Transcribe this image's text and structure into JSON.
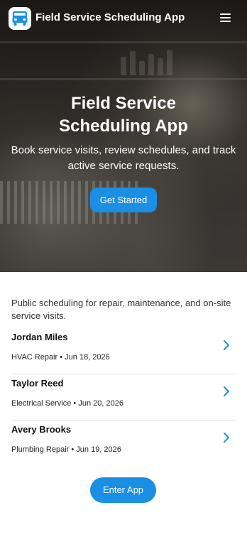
{
  "header": {
    "title": "Field Service Scheduling App",
    "logo_icon": "service-van-icon",
    "menu_icon": "hamburger-menu-icon"
  },
  "hero": {
    "title": "Field Service Scheduling App",
    "subtitle": "Book service visits, review schedules, and track active service requests.",
    "cta_label": "Get Started"
  },
  "main": {
    "intro": "Public scheduling for repair, maintenance, and on-site service visits.",
    "visits": [
      {
        "name": "Jordan Miles",
        "meta": "HVAC Repair • Jun 18, 2026"
      },
      {
        "name": "Taylor Reed",
        "meta": "Electrical Service • Jun 20, 2026"
      },
      {
        "name": "Avery Brooks",
        "meta": "Plumbing Repair • Jun 19, 2026"
      }
    ],
    "enter_label": "Enter App"
  },
  "colors": {
    "accent": "#1a8fe3",
    "logo": "#1a8fe3"
  }
}
